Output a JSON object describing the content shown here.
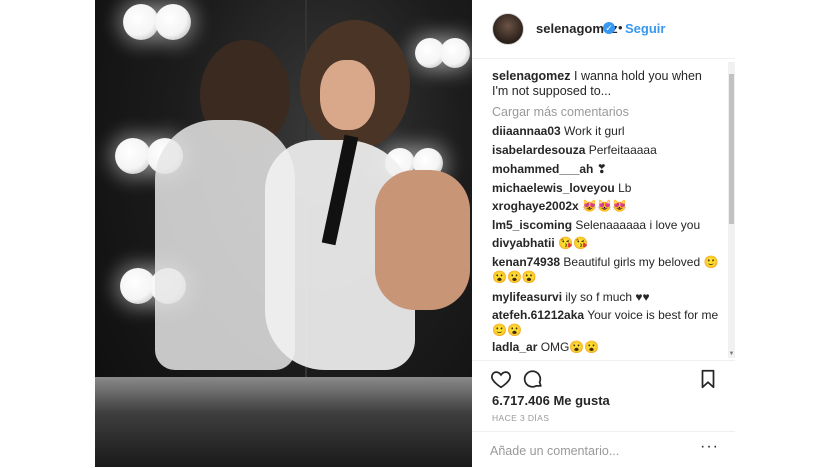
{
  "post": {
    "username": "selenagomez",
    "verified_mark": "✓",
    "dot": "•",
    "follow_label": "Seguir",
    "caption_user": "selenagomez",
    "caption_text": "I wanna hold you when I'm not supposed to...",
    "load_more": "Cargar más comentarios",
    "likes": "6.717.406 Me gusta",
    "time_ago": "HACE 3 DÍAS",
    "add_comment_placeholder": "Añade un comentario...",
    "more_options": "···"
  },
  "comments": [
    {
      "user": "diiaannaa03",
      "text": "Work it gurl"
    },
    {
      "user": "isabelardesouza",
      "text": "Perfeitaaaaa"
    },
    {
      "user": "mohammed___ah",
      "text": "❣"
    },
    {
      "user": "michaelewis_loveyou",
      "text": "Lb"
    },
    {
      "user": "xroghaye2002x",
      "text": "😻😻😻"
    },
    {
      "user": "lm5_iscoming",
      "text": "Selenaaaaaa i love you"
    },
    {
      "user": "divyabhatii",
      "text": "😘😘"
    },
    {
      "user": "kenan74938",
      "text": "Beautiful girls my beloved 🙂😮😮😮"
    },
    {
      "user": "mylifeasurvi",
      "text": "ily so f much ♥♥"
    },
    {
      "user": "atefeh.61212aka",
      "text": "Your voice is best for me 🙂😮"
    },
    {
      "user": "ladla_ar",
      "text": "OMG😮😮"
    }
  ],
  "icons": {
    "like": "heart-icon",
    "comment": "comment-icon",
    "save": "bookmark-icon"
  },
  "colors": {
    "link": "#3897f0",
    "muted": "#999999",
    "text": "#262626"
  }
}
